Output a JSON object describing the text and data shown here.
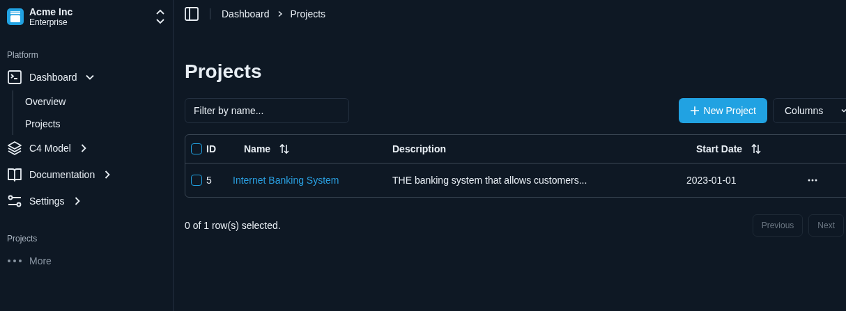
{
  "team": {
    "name": "Acme Inc",
    "plan": "Enterprise"
  },
  "sidebar": {
    "groups": [
      {
        "label": "Platform",
        "items": [
          {
            "label": "Dashboard",
            "expanded": true,
            "children": [
              {
                "label": "Overview"
              },
              {
                "label": "Projects"
              }
            ]
          },
          {
            "label": "C4 Model",
            "expanded": false
          },
          {
            "label": "Documentation",
            "expanded": false
          },
          {
            "label": "Settings",
            "expanded": false
          }
        ]
      },
      {
        "label": "Projects",
        "items": [
          {
            "label": "More",
            "muted": true
          }
        ]
      }
    ]
  },
  "breadcrumb": [
    "Dashboard",
    "Projects"
  ],
  "page_title": "Projects",
  "filter": {
    "placeholder": "Filter by name..."
  },
  "new_button": {
    "label": "New Project"
  },
  "columns_button": {
    "label": "Columns"
  },
  "table": {
    "select_all": {
      "checked": false
    },
    "columns": [
      {
        "label": "ID",
        "sortable": false
      },
      {
        "label": "Name",
        "sortable": true
      },
      {
        "label": "Description",
        "sortable": false
      },
      {
        "label": "Start Date",
        "sortable": true
      }
    ],
    "rows": [
      {
        "checked": false,
        "id": "5",
        "name": "Internet Banking System",
        "description": "THE banking system that allows customers...",
        "start_date": "2023-01-01"
      }
    ]
  },
  "selection_status": "0 of 1 row(s) selected.",
  "pagination": [
    {
      "label": "Previous",
      "disabled": true
    },
    {
      "label": "Next",
      "disabled": true
    }
  ]
}
